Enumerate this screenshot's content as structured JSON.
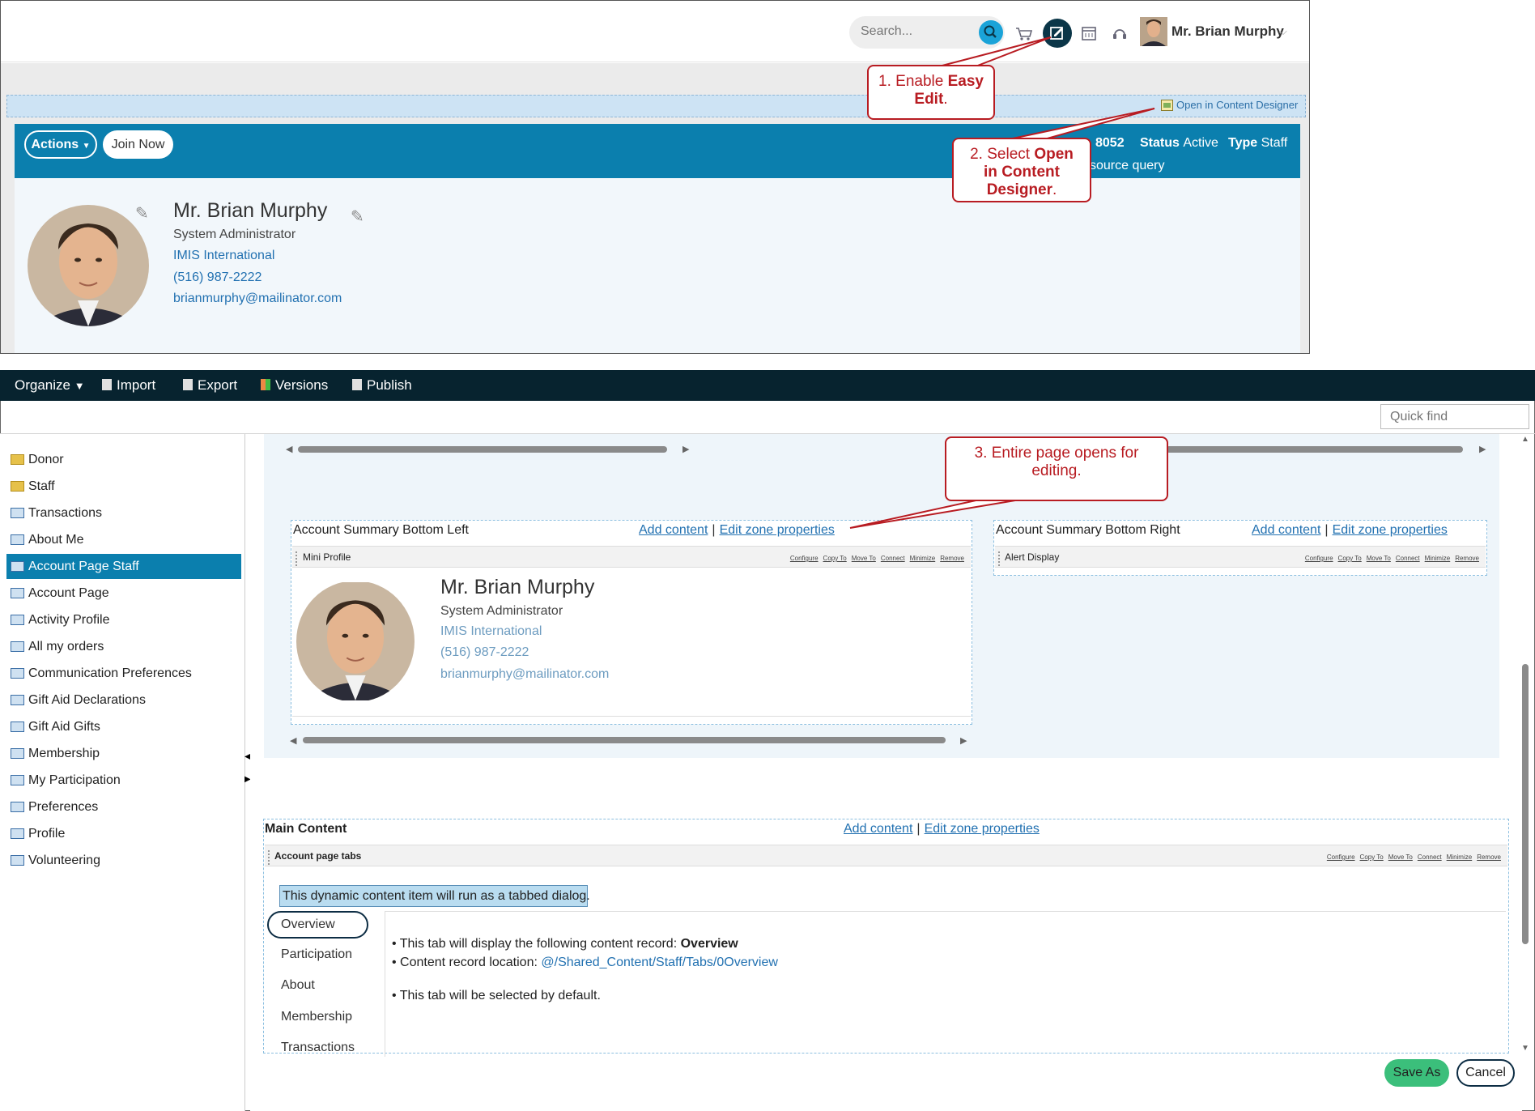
{
  "top": {
    "search": {
      "placeholder": "Search..."
    },
    "user": {
      "name": "Mr. Brian Murphy"
    },
    "easy_edit": {
      "designer_link": "Open in Content Designer"
    },
    "banner": {
      "actions_label": "Actions",
      "join_label": "Join Now",
      "id_fragment": "8052",
      "status_label": "Status",
      "status_value": "Active",
      "type_label": "Type",
      "type_value": "Staff",
      "source_fragment": "source query"
    },
    "profile": {
      "name": "Mr. Brian Murphy",
      "title": "System Administrator",
      "org": "IMIS International",
      "phone": "(516) 987-2222",
      "email": "brianmurphy@mailinator.com"
    }
  },
  "callouts": {
    "step1": {
      "prefix": "1. Enable ",
      "bold": "Easy Edit",
      "suffix": "."
    },
    "step2": {
      "prefix": "2. Select ",
      "bold": "Open in Content Designer",
      "suffix": "."
    },
    "step3": {
      "text": "3. Entire page opens for editing."
    }
  },
  "designer": {
    "toolbar": {
      "organize": "Organize",
      "import": "Import",
      "export": "Export",
      "versions": "Versions",
      "publish": "Publish"
    },
    "quick_find": {
      "placeholder": "Quick find"
    },
    "tree": [
      {
        "label": "Donor",
        "kind": "folder"
      },
      {
        "label": "Staff",
        "kind": "folder"
      },
      {
        "label": "Transactions",
        "kind": "page"
      },
      {
        "label": "About Me",
        "kind": "page"
      },
      {
        "label": "Account Page Staff",
        "kind": "page",
        "selected": true
      },
      {
        "label": "Account Page",
        "kind": "page"
      },
      {
        "label": "Activity Profile",
        "kind": "page"
      },
      {
        "label": "All my orders",
        "kind": "page"
      },
      {
        "label": "Communication Preferences",
        "kind": "page"
      },
      {
        "label": "Gift Aid Declarations",
        "kind": "page"
      },
      {
        "label": "Gift Aid Gifts",
        "kind": "page"
      },
      {
        "label": "Membership",
        "kind": "page"
      },
      {
        "label": "My Participation",
        "kind": "page"
      },
      {
        "label": "Preferences",
        "kind": "page"
      },
      {
        "label": "Profile",
        "kind": "page"
      },
      {
        "label": "Volunteering",
        "kind": "page"
      }
    ],
    "zones": {
      "bottom_left": {
        "title": "Account Summary Bottom Left",
        "add_content": "Add content",
        "edit_props": "Edit zone properties",
        "part_title": "Mini Profile"
      },
      "bottom_right": {
        "title": "Account Summary Bottom Right",
        "add_content": "Add content",
        "edit_props": "Edit zone properties",
        "part_title": "Alert Display"
      },
      "main": {
        "title": "Main Content",
        "add_content": "Add content",
        "edit_props": "Edit zone properties",
        "part_title": "Account page tabs"
      }
    },
    "part_actions": [
      "Configure",
      "Copy To",
      "Move To",
      "Connect",
      "Minimize",
      "Remove"
    ],
    "mini_profile": {
      "name": "Mr. Brian Murphy",
      "title": "System Administrator",
      "org": "IMIS International",
      "phone": "(516) 987-2222",
      "email": "brianmurphy@mailinator.com"
    },
    "tabs_notice": "This dynamic content item will run as a tabbed dialog.",
    "tabs": [
      "Overview",
      "Participation",
      "About",
      "Membership",
      "Transactions"
    ],
    "tab_body": {
      "line1_prefix": "• This tab will display the following content record: ",
      "line1_bold": "Overview",
      "line2_prefix": "• Content record location: ",
      "line2_link": "@/Shared_Content/Staff/Tabs/0Overview",
      "line3": "• This tab will be selected by default."
    },
    "buttons": {
      "save_as": "Save As",
      "cancel": "Cancel"
    }
  },
  "colors": {
    "banner": "#0b7fae",
    "toolbar": "#07232f",
    "callout": "#b81c22",
    "selected_tree": "#0b7fae",
    "save_button": "#3bbf7b"
  }
}
